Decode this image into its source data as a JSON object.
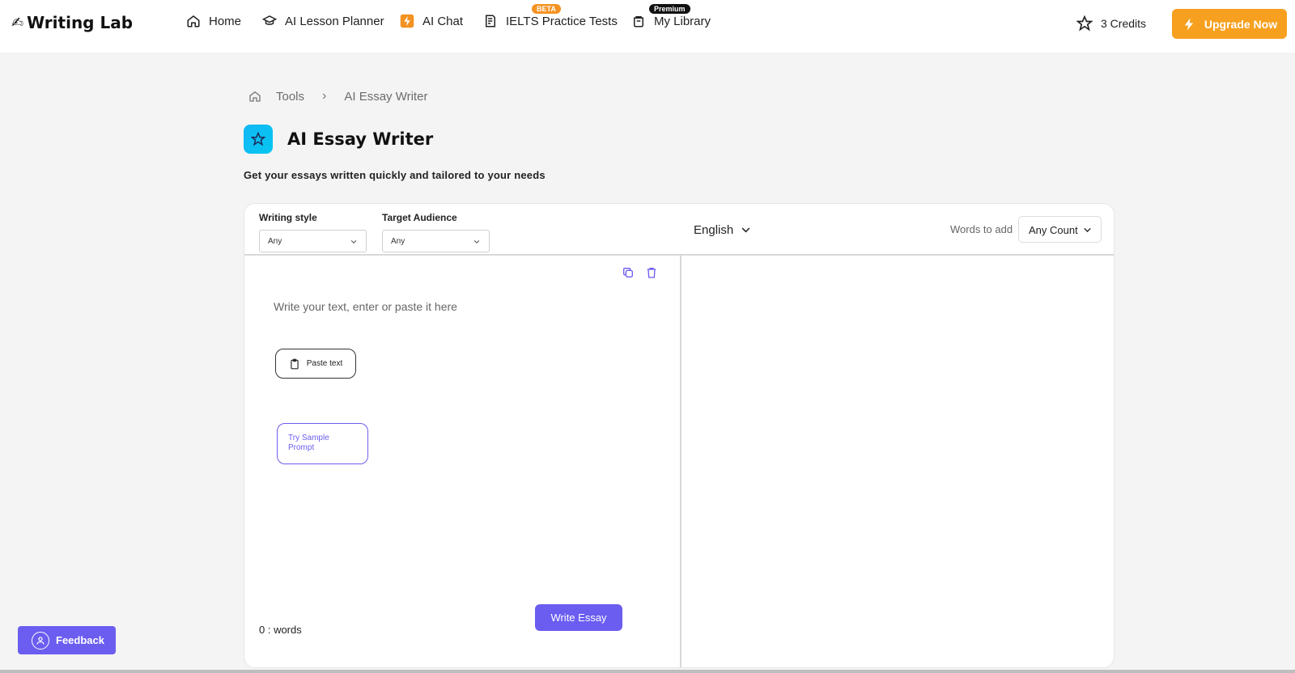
{
  "header": {
    "logo_text": "Writing Lab",
    "nav": [
      {
        "label": "Home",
        "icon": "home-icon"
      },
      {
        "label": "AI Lesson Planner",
        "icon": "graduation-cap-icon"
      },
      {
        "label": "AI Chat",
        "icon": "bolt-icon"
      },
      {
        "label": "IELTS Practice Tests",
        "icon": "test-document-icon",
        "badge": "BETA"
      },
      {
        "label": "My Library",
        "icon": "library-icon",
        "badge": "Premium"
      }
    ],
    "credits_label": "3 Credits",
    "upgrade_label": "Upgrade Now"
  },
  "breadcrumb": {
    "items": [
      "Tools",
      "AI Essay Writer"
    ]
  },
  "page": {
    "title": "AI Essay Writer",
    "subtitle": "Get your essays written quickly and tailored to your needs"
  },
  "options": {
    "writing_style_label": "Writing style",
    "writing_style_value": "Any",
    "target_audience_label": "Target Audience",
    "target_audience_value": "Any",
    "language_value": "English",
    "words_to_add_label": "Words to add",
    "word_count_value": "Any Count"
  },
  "editor": {
    "placeholder": "Write your text, enter or paste it here",
    "paste_label": "Paste text",
    "sample_label": "Try Sample Prompt",
    "word_count_text": "0 : words",
    "write_button_label": "Write Essay"
  },
  "feedback_label": "Feedback",
  "colors": {
    "accent": "#6b5df0",
    "upgrade": "#f7a01f",
    "title_icon": "#12b8f5"
  }
}
